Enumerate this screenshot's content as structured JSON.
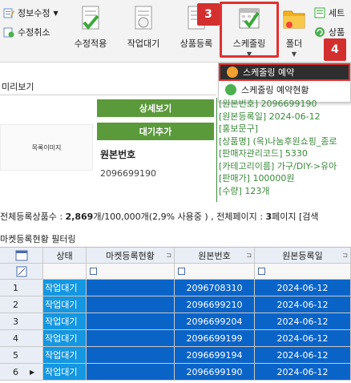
{
  "ribbon": {
    "small_buttons": [
      {
        "label": "정보수정",
        "has_dropdown": true
      },
      {
        "label": "수정취소"
      }
    ],
    "big_buttons": [
      {
        "label": "수정적용"
      },
      {
        "label": "작업대기"
      },
      {
        "label": "상품등록"
      },
      {
        "label": "스케줄링"
      },
      {
        "label": "폴더"
      }
    ],
    "right_buttons": [
      {
        "label": "세트"
      },
      {
        "label": "상품"
      }
    ],
    "badges": [
      "3",
      "4"
    ]
  },
  "dropdown": {
    "items": [
      {
        "label": "스케줄링 예약",
        "active": true
      },
      {
        "label": "스케줄링 예약현황",
        "active": false
      }
    ]
  },
  "preview": {
    "title": "미리보기",
    "thumbnail_text": "목록이미지",
    "detail_button": "상세보기",
    "queue_button": "대기추가",
    "original_label": "원본번호",
    "original_value": "2096699190",
    "info_lines": [
      "[원본번호] 2096699190",
      "[원본등록일] 2024-06-12",
      "[홍보문구]",
      "[상품명] (옥)나눔후원쇼핑_종로",
      "[판매자관리코드] 5330",
      "[카테고리이름] 가구/DIY->유아",
      "[판매가] 100000원",
      "[수량] 123개"
    ]
  },
  "status": {
    "prefix": "전체등록상품수 : ",
    "count": "2,869",
    "suffix1": "개/100,000개(2,9% 사용중 ) , 전체페이지 : ",
    "pages": "3",
    "suffix2": "페이지 [검색"
  },
  "filter_label": "마켓등록현황 필터링",
  "grid": {
    "columns": [
      "상태",
      "마켓등록현황",
      "원본번호",
      "원본등록일"
    ],
    "rows": [
      {
        "num": "1",
        "status": "작업대기",
        "orig": "2096708310",
        "date": "2024-06-12"
      },
      {
        "num": "2",
        "status": "작업대기",
        "orig": "2096699210",
        "date": "2024-06-12"
      },
      {
        "num": "3",
        "status": "작업대기",
        "orig": "2096699204",
        "date": "2024-06-12"
      },
      {
        "num": "4",
        "status": "작업대기",
        "orig": "2096699199",
        "date": "2024-06-12"
      },
      {
        "num": "5",
        "status": "작업대기",
        "orig": "2096699194",
        "date": "2024-06-12"
      },
      {
        "num": "6",
        "status": "작업대기",
        "orig": "2096699190",
        "date": "2024-06-12"
      }
    ]
  },
  "colors": {
    "highlight": "#e03030",
    "selection": "#0a64c8",
    "status_cell": "#1496e0",
    "green_button": "#5b9a3b"
  }
}
